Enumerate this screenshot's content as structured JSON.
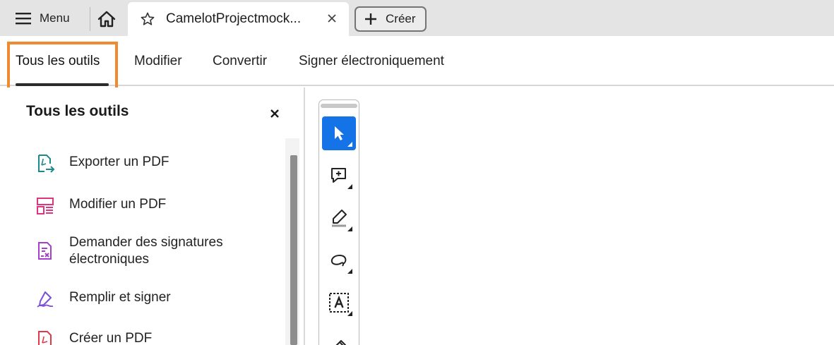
{
  "titlebar": {
    "menu_label": "Menu",
    "document_tab_title": "CamelotProjectmock...",
    "create_label": "Créer"
  },
  "nav": {
    "tabs": [
      {
        "label": "Tous les outils",
        "active": true
      },
      {
        "label": "Modifier",
        "active": false
      },
      {
        "label": "Convertir",
        "active": false
      },
      {
        "label": "Signer électroniquement",
        "active": false
      }
    ]
  },
  "panel": {
    "title": "Tous les outils",
    "items": [
      {
        "label": "Exporter un PDF",
        "icon": "export-pdf-icon",
        "color": "#1a8a8a"
      },
      {
        "label": "Modifier un PDF",
        "icon": "edit-pdf-icon",
        "color": "#e0357d"
      },
      {
        "label": "Demander des signatures électroniques",
        "icon": "request-signatures-icon",
        "color": "#a63fc9"
      },
      {
        "label": "Remplir et signer",
        "icon": "fill-sign-icon",
        "color": "#7b4fd6"
      },
      {
        "label": "Créer un PDF",
        "icon": "create-pdf-icon",
        "color": "#e0394a"
      }
    ]
  },
  "toolbar": {
    "tools": [
      {
        "icon": "select-cursor-icon",
        "selected": true
      },
      {
        "icon": "add-comment-icon",
        "selected": false
      },
      {
        "icon": "highlight-pen-icon",
        "selected": false
      },
      {
        "icon": "lasso-draw-icon",
        "selected": false
      },
      {
        "icon": "text-box-select-icon",
        "selected": false
      },
      {
        "icon": "eraser-icon",
        "selected": false
      }
    ]
  },
  "colors": {
    "accent": "#1473e6",
    "focus_ring": "#f08a30",
    "titlebar_bg": "#e4e4e4"
  }
}
